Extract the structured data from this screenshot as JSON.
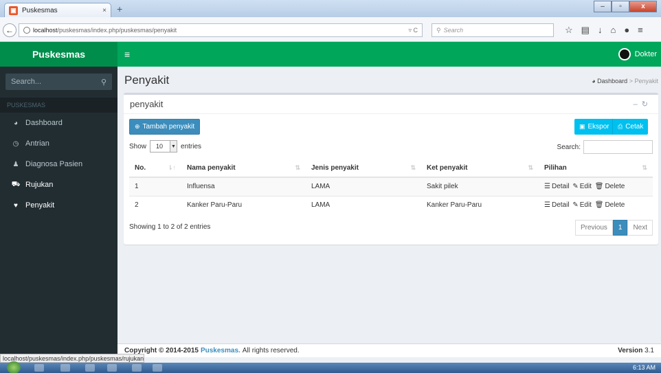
{
  "browser": {
    "tab_title": "Puskesmas",
    "tab_close": "×",
    "new_tab": "+",
    "url_host": "localhost",
    "url_path": "/puskesmas/index.php/puskesmas/penyakit",
    "search_placeholder": "Search",
    "window_buttons": [
      "–",
      "▫",
      "x"
    ],
    "status_url": "localhost/puskesmas/index.php/puskesmas/rujukan"
  },
  "header": {
    "brand": "Puskesmas",
    "menu_icon": "≡",
    "user_name": "Dokter"
  },
  "sidebar": {
    "search_placeholder": "Search...",
    "section_header": "PUSKESMAS",
    "items": [
      {
        "label": "Dashboard",
        "icon": "dashboard-icon"
      },
      {
        "label": "Antrian",
        "icon": "clock-icon"
      },
      {
        "label": "Diagnosa Pasien",
        "icon": "user-md-icon"
      },
      {
        "label": "Rujukan",
        "icon": "ambulance-icon"
      },
      {
        "label": "Penyakit",
        "icon": "heartbeat-icon"
      }
    ]
  },
  "page": {
    "title": "Penyakit",
    "breadcrumb": {
      "home": "Dashboard",
      "separator": ">",
      "current": "Penyakit"
    }
  },
  "box": {
    "title": "penyakit",
    "add_button": "Tambah penyakit",
    "export_button": "Ekspor",
    "print_button": "Cetak",
    "length_prefix": "Show",
    "length_value": "10",
    "length_suffix": "entries",
    "search_label": "Search:",
    "columns": [
      "No.",
      "Nama penyakit",
      "Jenis penyakit",
      "Ket penyakit",
      "Pilihan"
    ],
    "rows": [
      {
        "no": "1",
        "nama": "Influensa",
        "jenis": "LAMA",
        "ket": "Sakit pilek"
      },
      {
        "no": "2",
        "nama": "Kanker Paru-Paru",
        "jenis": "LAMA",
        "ket": "Kanker Paru-Paru"
      }
    ],
    "actions": {
      "detail": "Detail",
      "edit": "Edit",
      "delete": "Delete"
    },
    "info": "Showing 1 to 2 of 2 entries",
    "pagination": {
      "previous": "Previous",
      "current": "1",
      "next": "Next"
    }
  },
  "footer": {
    "copyright_prefix": "Copyright © 2014-2015",
    "brand": "Puskesmas.",
    "rights": "All rights reserved.",
    "version_label": "Version",
    "version_value": "3.1"
  },
  "taskbar": {
    "clock": "6:13 AM"
  },
  "colors": {
    "brand_dark": "#008d4c",
    "brand": "#00a65a",
    "sidebar": "#222d32",
    "primary": "#3c8dbc",
    "info": "#00c0ef"
  }
}
